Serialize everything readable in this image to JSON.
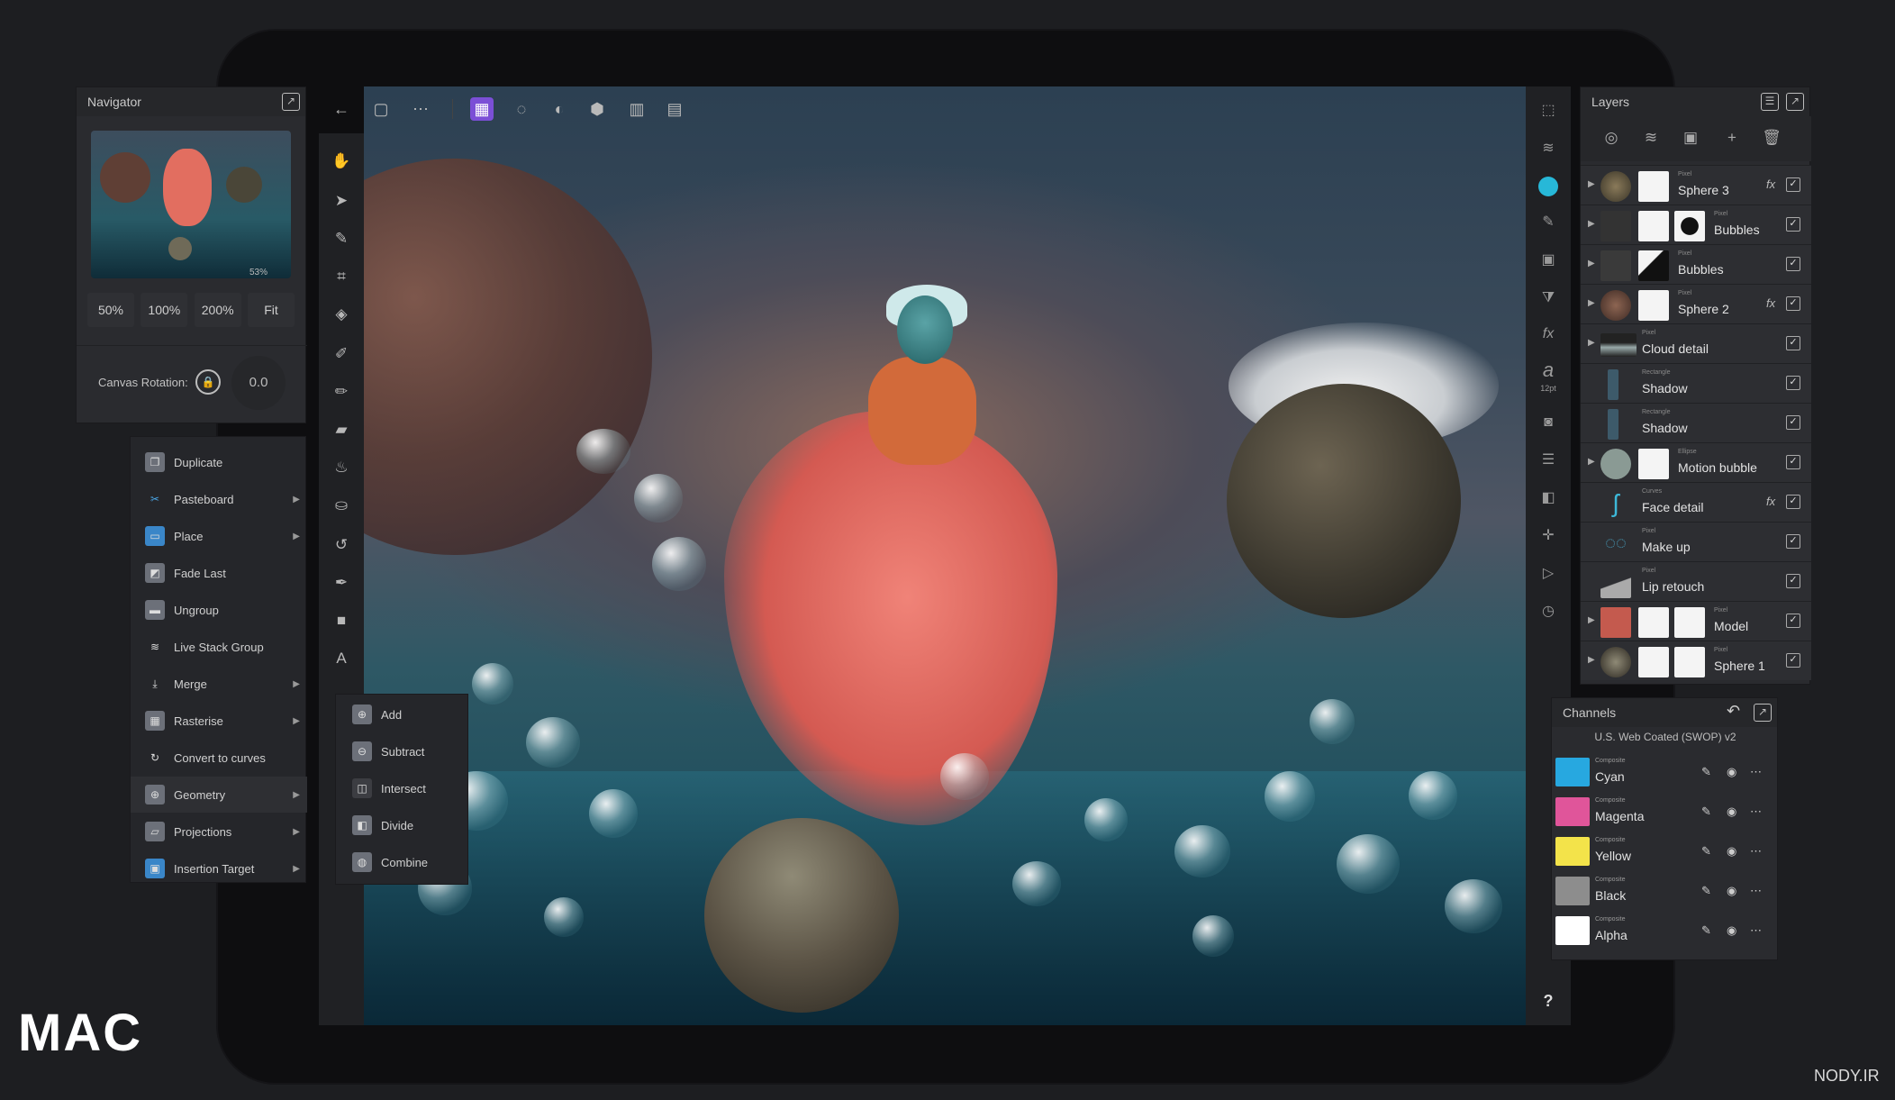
{
  "toolbar": {
    "icons": [
      "back-arrow-icon",
      "document-icon",
      "more-icon",
      "pixel-persona-icon",
      "selection-icon",
      "develop-icon",
      "tone-map-icon",
      "liquify-icon",
      "export-icon"
    ]
  },
  "navigator": {
    "title": "Navigator",
    "zoom_readout": "53%",
    "zoom_buttons": [
      "50%",
      "100%",
      "200%",
      "Fit"
    ],
    "rotation_label": "Canvas Rotation:",
    "rotation_value": "0.0"
  },
  "context_menu": {
    "items": [
      {
        "label": "Duplicate",
        "icon": "duplicate-icon",
        "submenu": false
      },
      {
        "label": "Pasteboard",
        "icon": "scissors-icon",
        "submenu": true
      },
      {
        "label": "Place",
        "icon": "place-icon",
        "submenu": true
      },
      {
        "label": "Fade Last",
        "icon": "fade-icon",
        "submenu": false
      },
      {
        "label": "Ungroup",
        "icon": "folder-icon",
        "submenu": false
      },
      {
        "label": "Live Stack Group",
        "icon": "stack-icon",
        "submenu": false
      },
      {
        "label": "Merge",
        "icon": "merge-icon",
        "submenu": true
      },
      {
        "label": "Rasterise",
        "icon": "rasterise-icon",
        "submenu": true
      },
      {
        "label": "Convert to curves",
        "icon": "curves-icon",
        "submenu": false
      },
      {
        "label": "Geometry",
        "icon": "geometry-icon",
        "submenu": true
      },
      {
        "label": "Projections",
        "icon": "projection-icon",
        "submenu": true
      },
      {
        "label": "Insertion Target",
        "icon": "insertion-icon",
        "submenu": true
      }
    ]
  },
  "geometry_submenu": {
    "items": [
      "Add",
      "Subtract",
      "Intersect",
      "Divide",
      "Combine"
    ]
  },
  "layers": {
    "title": "Layers",
    "rows": [
      {
        "type": "Pixel",
        "name": "Sphere 3",
        "fx": true,
        "expand": true
      },
      {
        "type": "Pixel",
        "name": "Bubbles",
        "fx": false,
        "expand": true
      },
      {
        "type": "Pixel",
        "name": "Bubbles",
        "fx": false,
        "expand": true
      },
      {
        "type": "Pixel",
        "name": "Sphere 2",
        "fx": true,
        "expand": true
      },
      {
        "type": "Pixel",
        "name": "Cloud detail",
        "fx": false,
        "expand": true
      },
      {
        "type": "Rectangle",
        "name": "Shadow",
        "fx": false,
        "expand": false
      },
      {
        "type": "Rectangle",
        "name": "Shadow",
        "fx": false,
        "expand": false
      },
      {
        "type": "Ellipse",
        "name": "Motion bubble",
        "fx": false,
        "expand": true
      },
      {
        "type": "Curves",
        "name": "Face detail",
        "fx": true,
        "expand": false
      },
      {
        "type": "Pixel",
        "name": "Make up",
        "fx": false,
        "expand": false
      },
      {
        "type": "Pixel",
        "name": "Lip retouch",
        "fx": false,
        "expand": false
      },
      {
        "type": "Pixel",
        "name": "Model",
        "fx": false,
        "expand": true
      },
      {
        "type": "Pixel",
        "name": "Sphere 1",
        "fx": false,
        "expand": true
      }
    ],
    "fx_label": "fx",
    "check": "✓"
  },
  "channels": {
    "title": "Channels",
    "profile": "U.S. Web Coated (SWOP) v2",
    "rows": [
      {
        "type": "Composite",
        "name": "Cyan",
        "color": "#27a8e0"
      },
      {
        "type": "Composite",
        "name": "Magenta",
        "color": "#e0559a"
      },
      {
        "type": "Composite",
        "name": "Yellow",
        "color": "#f3e34a"
      },
      {
        "type": "Composite",
        "name": "Black",
        "color": "#8d8d8d"
      },
      {
        "type": "Composite",
        "name": "Alpha",
        "color": "#ffffff"
      }
    ]
  },
  "right_strip": {
    "font_size_label": "12pt",
    "help": "?"
  },
  "watermark": {
    "site": "NODY.IR",
    "logo": "MAC"
  },
  "colors": {
    "accent": "#27b8d8",
    "background": "#1d1e21",
    "panel": "#2a2b2f"
  }
}
